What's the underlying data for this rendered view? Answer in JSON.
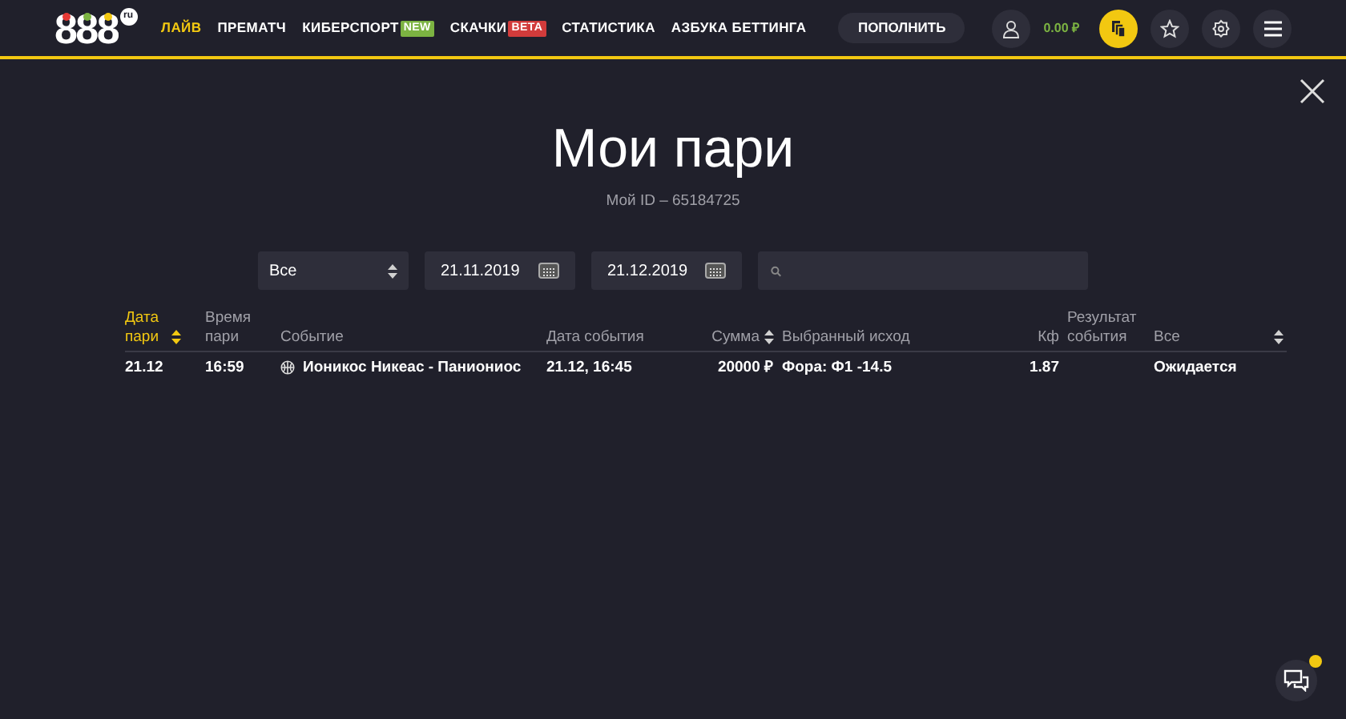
{
  "header": {
    "logo": {
      "digits": [
        "8",
        "8",
        "8"
      ],
      "suffix": "ru"
    },
    "nav": [
      {
        "label": "ЛАЙВ",
        "selected": true
      },
      {
        "label": "ПРЕМАТЧ",
        "selected": false
      },
      {
        "label": "КИБЕРСПОРТ",
        "selected": false,
        "badge": {
          "text": "NEW",
          "color": "#7cb342"
        }
      },
      {
        "label": "СКАЧКИ",
        "selected": false,
        "badge": {
          "text": "BETA",
          "color": "#d23b3b"
        }
      },
      {
        "label": "СТАТИСТИКА",
        "selected": false
      },
      {
        "label": "АЗБУКА БЕТТИНГА",
        "selected": false
      }
    ],
    "deposit_button": "ПОПОЛНИТЬ",
    "balance": "0.00 ₽"
  },
  "title": "Мои пари",
  "user_id": "Мой ID – 65184725",
  "filters": {
    "status": "Все",
    "date_from": "21.11.2019",
    "date_to": "21.12.2019"
  },
  "table": {
    "columns": [
      {
        "label": "Дата пари",
        "sortable": true,
        "selected": true
      },
      {
        "label": "Время пари",
        "sortable": false,
        "selected": false
      },
      {
        "label": "Событие",
        "sortable": false,
        "selected": false
      },
      {
        "label": "Дата события",
        "sortable": false,
        "selected": false
      },
      {
        "label": "Сумма",
        "sortable": true,
        "selected": false
      },
      {
        "label": "Выбранный исход",
        "sortable": false,
        "selected": false
      },
      {
        "label": "Кф",
        "sortable": false,
        "selected": false
      },
      {
        "label": "Результат события",
        "sortable": false,
        "selected": false
      },
      {
        "label": "Все",
        "sortable": true,
        "selected": false
      }
    ],
    "rows": [
      {
        "cells": [
          "21.12",
          "16:59",
          "Ионикос Никеас - Паниониос",
          "21.12, 16:45",
          "20000 ₽",
          "Фора: Ф1 -14.5",
          "1.87",
          "",
          "Ожидается"
        ]
      }
    ]
  },
  "chat": {
    "unread": true
  }
}
